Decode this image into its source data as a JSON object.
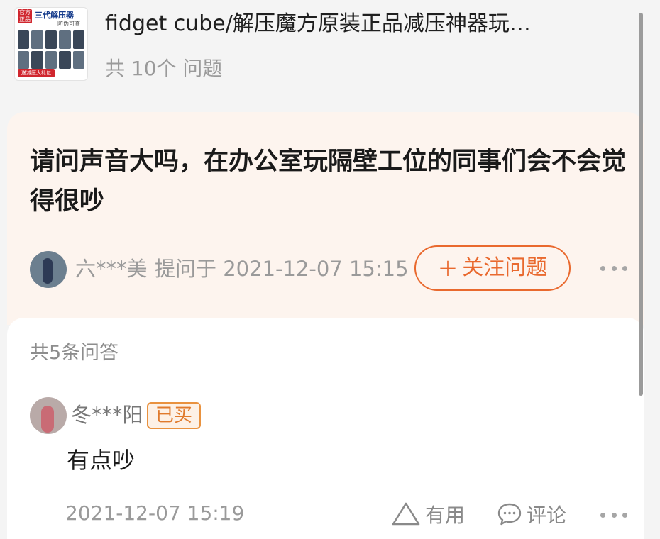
{
  "product": {
    "thumbnail": {
      "badge": "官方正品",
      "title": "三代解压器",
      "subtitle": "防伪可查",
      "ribbon": "送减压大礼包"
    },
    "title": "fidget cube/解压魔方原装正品减压神器玩…",
    "question_count_label": "共 10个 问题"
  },
  "question": {
    "text": "请问声音大吗，在办公室玩隔壁工位的同事们会不会觉得很吵",
    "asker_name": "六***美",
    "asked_time": "提问于 2021-12-07 15:15",
    "follow_button_icon": "plus-icon",
    "follow_button_label": "关注问题",
    "more_icon": "more-icon"
  },
  "answers": {
    "count_label": "共5条问答",
    "items": [
      {
        "name": "冬***阳",
        "badge": "已买",
        "text": "有点吵",
        "time": "2021-12-07 15:19",
        "useful_label": "有用",
        "comment_label": "评论"
      }
    ]
  },
  "colors": {
    "accent": "#e9692e",
    "question_bg": "#fdf4ee",
    "page_bg": "#f4f4f4"
  }
}
